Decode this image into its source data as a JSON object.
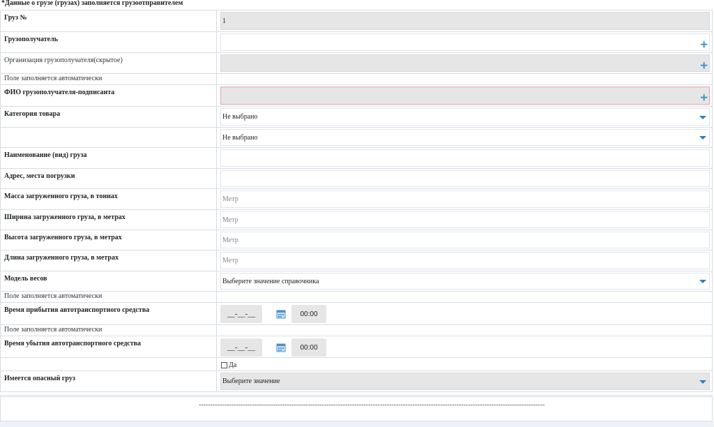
{
  "header": "*Данные о грузе (грузах) заполняется грузоотправителем",
  "rows": {
    "cargo_no": {
      "label": "Груз №",
      "value": "1"
    },
    "consignee": {
      "label": "Грузополучатель"
    },
    "consignee_org": {
      "label": "Организация грузополучателя(скрытое)"
    },
    "auto1": {
      "label": "Поле заполняется автоматически"
    },
    "signer": {
      "label": "ФИО грузополучателя-подписанта"
    },
    "category": {
      "label": "Категория товара",
      "value": "Не выбрано"
    },
    "category2": {
      "value": "Не выбрано"
    },
    "cargo_name": {
      "label": "Наименование (вид) груза"
    },
    "address": {
      "label": "Адрес, места погрузки"
    },
    "mass": {
      "label": "Масса загруженного груза, в тоннах",
      "placeholder": "Метр"
    },
    "width": {
      "label": "Ширина загруженного груза, в метрах",
      "placeholder": "Метр"
    },
    "height": {
      "label": "Высота загруженного груза, в метрах",
      "placeholder": "Метр"
    },
    "length": {
      "label": "Длина загруженного груза, в метрах",
      "placeholder": "Метр"
    },
    "scale_model": {
      "label": "Модель весов",
      "value": "Выберите значение справочника"
    },
    "auto2": {
      "label": "Поле заполняется автоматически"
    },
    "arrival": {
      "label": "Время прибытия автотранспортного средства",
      "date": "__-__-__",
      "time": "00:00"
    },
    "auto3": {
      "label": "Поле заполняется автоматически"
    },
    "departure": {
      "label": "Время убытия автотранспортного средства",
      "date": "__-__-__",
      "time": "00:00"
    },
    "yes_checkbox": {
      "label": "Да"
    },
    "dangerous": {
      "label": "Имеется опасный груз",
      "value": "Выберите значение"
    }
  },
  "footer": {
    "dashes": "-----------------------------------------------------------------------------------------------------------------------------------------------------"
  },
  "icons": {
    "plus": "+",
    "accent": "#2a8ad9"
  }
}
